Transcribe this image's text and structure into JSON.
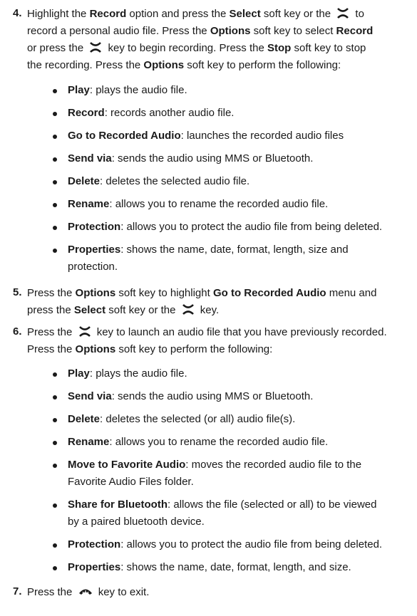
{
  "step4": {
    "num": "4.",
    "t1": "Highlight the ",
    "b1": "Record",
    "t2": " option and press the ",
    "b2": "Select",
    "t3": " soft key or the ",
    "t4": " to",
    "l2": "record a personal audio file. Press the ",
    "b3": "Options",
    "t5": " soft key to select ",
    "b4": "Record",
    "l3a": "or press the ",
    "l3b": " key to begin recording.  Press the ",
    "b5": "Stop",
    "l3c": " soft key to stop",
    "l4a": "the recording. Press the ",
    "b6": "Options",
    "l4b": " soft key to perform the following:"
  },
  "list4": [
    {
      "label": "Play",
      "desc": ": plays the audio file."
    },
    {
      "label": "Record",
      "desc": ": records another audio file."
    },
    {
      "label": "Go to Recorded Audio",
      "desc": ": launches the recorded audio files"
    },
    {
      "label": "Send via",
      "desc": ": sends the audio using MMS or Bluetooth."
    },
    {
      "label": "Delete",
      "desc": ": deletes the selected audio file."
    },
    {
      "label": "Rename",
      "desc": ": allows you to rename the recorded audio file."
    },
    {
      "label": "Protection",
      "desc": ": allows you to protect the audio file from being deleted."
    },
    {
      "label": "Properties",
      "desc": ": shows the name, date, format, length, size and",
      "desc2": "protection."
    }
  ],
  "step5": {
    "num": "5.",
    "a": "Press the ",
    "b1": "Options",
    "c": " soft key to highlight ",
    "b2": "Go to Recorded Audio",
    "d": " menu and",
    "e": "press the ",
    "b3": "Select",
    "f": " soft key or the ",
    "g": " key."
  },
  "step6": {
    "num": "6.",
    "a": "Press the ",
    "b": " key to launch an audio file that you have previously recorded.",
    "c": "Press the ",
    "b1": "Options",
    "d": " soft key to perform the following:"
  },
  "list6": [
    {
      "label": "Play",
      "desc": ": plays the audio file."
    },
    {
      "label": "Send via",
      "desc": ": sends the audio using MMS or Bluetooth."
    },
    {
      "label": "Delete",
      "desc": ": deletes the selected (or all) audio file(s)."
    },
    {
      "label": "Rename",
      "desc": ": allows you to rename the recorded audio file."
    },
    {
      "label": "Move to Favorite Audio",
      "desc": ": moves the recorded audio file to the",
      "desc2": "Favorite Audio Files folder."
    },
    {
      "label": "Share for Bluetooth",
      "desc": ": allows the file (selected or all) to be viewed",
      "desc2": "by a paired bluetooth device."
    },
    {
      "label": "Protection",
      "desc": ": allows you to protect the audio file from being deleted."
    },
    {
      "label": "Properties",
      "desc": ": shows the name, date, format, length, and size."
    }
  ],
  "step7": {
    "num": "7.",
    "a": "Press the ",
    "b": " key to exit."
  },
  "icons": {
    "ok_key": "x-key-icon",
    "end_key": "end-key-icon"
  }
}
